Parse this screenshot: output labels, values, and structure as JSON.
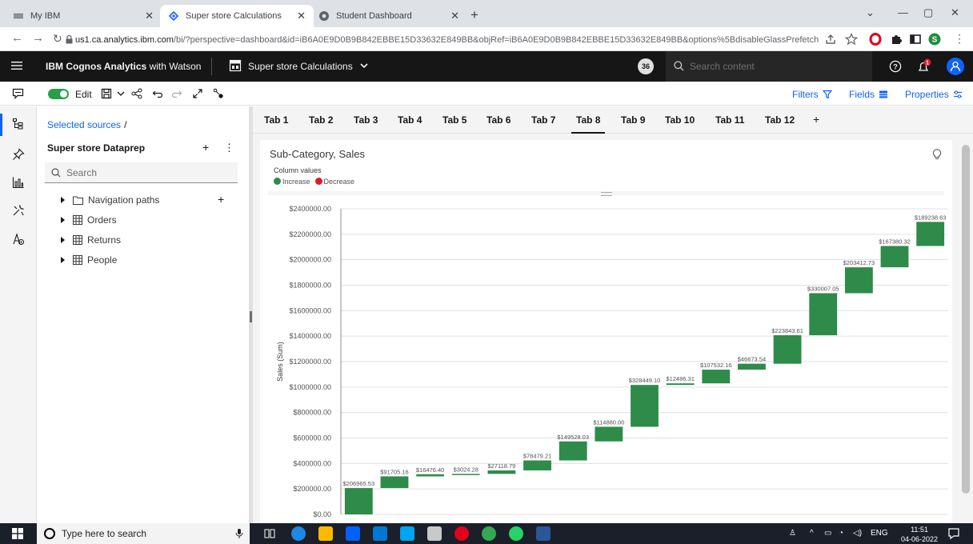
{
  "browser": {
    "tabs": [
      {
        "title": "My IBM",
        "active": false
      },
      {
        "title": "Super store Calculations",
        "active": true
      },
      {
        "title": "Student Dashboard",
        "active": false
      }
    ],
    "url_host": "us1.ca.analytics.ibm.com",
    "url_rest": "/bi/?perspective=dashboard&id=iB6A0E9D0B9B842EBBE15D33632E849BB&objRef=iB6A0E9D0B9B842EBBE15D33632E849BB&options%5BdisableGlassPrefetch..."
  },
  "app": {
    "brand_bold": "IBM Cognos Analytics",
    "brand_rest": " with Watson",
    "dashboard_title": "Super store Calculations",
    "notification_count": "36",
    "search_placeholder": "Search content"
  },
  "toolbar": {
    "edit_label": "Edit",
    "filters_label": "Filters",
    "fields_label": "Fields",
    "properties_label": "Properties"
  },
  "panel": {
    "breadcrumb": "Selected sources",
    "source_title": "Super store Dataprep",
    "search_placeholder": "Search",
    "items": [
      {
        "label": "Navigation paths",
        "icon": "folder-icon"
      },
      {
        "label": "Orders",
        "icon": "table-icon"
      },
      {
        "label": "Returns",
        "icon": "table-icon"
      },
      {
        "label": "People",
        "icon": "table-icon"
      }
    ]
  },
  "tabs": [
    "Tab 1",
    "Tab 2",
    "Tab 3",
    "Tab 4",
    "Tab 5",
    "Tab 6",
    "Tab 7",
    "Tab 8",
    "Tab 9",
    "Tab 10",
    "Tab 11",
    "Tab 12"
  ],
  "active_tab": "Tab 8",
  "widget": {
    "title": "Sub-Category, Sales",
    "legend_title": "Column values",
    "legend_increase": "Increase",
    "legend_decrease": "Decrease"
  },
  "colors": {
    "increase": "#2e8b4a",
    "decrease": "#da1e28",
    "accent": "#0f62fe"
  },
  "chart_data": {
    "type": "bar",
    "subtype": "waterfall",
    "ylabel": "Sales (Sum)",
    "ylim": [
      0,
      2400000
    ],
    "yticks": [
      "$0.00",
      "$200000.00",
      "$400000.00",
      "$600000.00",
      "$800000.00",
      "$1000000.00",
      "$1200000.00",
      "$1400000.00",
      "$1600000.00",
      "$1800000.00",
      "$2000000.00",
      "$2200000.00",
      "$2400000.00"
    ],
    "grid": true,
    "values": [
      206965.53,
      91705.16,
      16476.4,
      3024.28,
      27118.79,
      78479.21,
      149528.03,
      114880.0,
      328449.1,
      12486.31,
      107532.16,
      46673.54,
      223843.61,
      330007.05,
      203412.73,
      167380.32,
      189238.63
    ],
    "labels": [
      "$206965.53",
      "$91705.16",
      "$16476.40",
      "$3024.28",
      "$27118.79",
      "$78479.21",
      "$149528.03",
      "$114880.00",
      "$328449.10",
      "$12486.31",
      "$107532.16",
      "$46673.54",
      "$223843.61",
      "$330007.05",
      "$203412.73",
      "$167380.32",
      "$189238.63"
    ]
  },
  "taskbar": {
    "search_placeholder": "Type here to search",
    "language": "ENG",
    "time": "11:51",
    "date": "04-06-2022"
  }
}
